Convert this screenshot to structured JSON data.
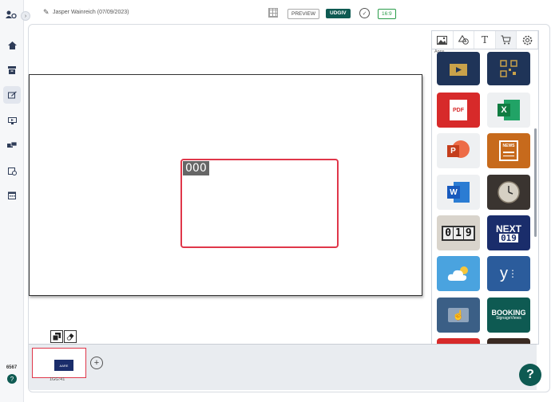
{
  "header": {
    "title": "Jasper Wainreich (07/09/2023)",
    "preview_label": "PREVIEW",
    "publish_label": "UDGIV",
    "ratio_label": "16:9"
  },
  "sidebar": {
    "items": [
      {
        "icon": "home-icon"
      },
      {
        "icon": "archive-icon"
      },
      {
        "icon": "edit-display-icon",
        "active": true
      },
      {
        "icon": "screen-icon"
      },
      {
        "icon": "devices-icon"
      },
      {
        "icon": "schedule-icon"
      },
      {
        "icon": "calendar-icon"
      }
    ],
    "version": "6567"
  },
  "canvas": {
    "zone_label": "000"
  },
  "panel": {
    "tabs": [
      {
        "icon": "image-icon",
        "glyph": "▣"
      },
      {
        "icon": "shapes-icon",
        "glyph": "△"
      },
      {
        "icon": "text-icon",
        "glyph": "T"
      },
      {
        "icon": "cart-icon",
        "glyph": "🛒"
      },
      {
        "icon": "settings-icon",
        "glyph": "⚙"
      }
    ],
    "section_label": "Apps",
    "apps": [
      {
        "name": "video-app",
        "glyph": "▶",
        "color": "#1f3458"
      },
      {
        "name": "qr-app",
        "glyph": "▦",
        "color": "#1f3458"
      },
      {
        "name": "pdf-app",
        "glyph": "PDF",
        "color": "#d72a2a"
      },
      {
        "name": "excel-app",
        "glyph": "X",
        "color": "#eef0f2"
      },
      {
        "name": "powerpoint-app",
        "glyph": "P",
        "color": "#eef0f2"
      },
      {
        "name": "news-app",
        "glyph": "NEWS",
        "color": "#c76a1c"
      },
      {
        "name": "word-app",
        "glyph": "W",
        "color": "#eef0f2"
      },
      {
        "name": "clock-app",
        "glyph": "🕓",
        "color": "#3a3430"
      },
      {
        "name": "counter-app",
        "glyph": "019",
        "color": "#d9d4cc"
      },
      {
        "name": "next-app",
        "glyph": "NEXT 019",
        "color": "#1a2d6b"
      },
      {
        "name": "weather-app",
        "glyph": "☁",
        "color": "#4aa3df"
      },
      {
        "name": "yammer-app",
        "glyph": "y",
        "color": "#2b5c9c"
      },
      {
        "name": "touch-app",
        "glyph": "☝",
        "color": "#3b5f86"
      },
      {
        "name": "booking-app",
        "glyph": "BOOKING",
        "subtitle": "SignageViews",
        "color": "#0e5a52"
      },
      {
        "name": "red-app",
        "glyph": "",
        "color": "#d72a2a"
      },
      {
        "name": "dark-app",
        "glyph": "",
        "color": "#3a2a22"
      }
    ]
  },
  "timeline": {
    "slide_label": "1GG:41",
    "thumb_text": "AARE"
  },
  "colors": {
    "accent": "#0e5a52",
    "zone_border": "#e0374a",
    "ratio": "#2a9d4a"
  }
}
